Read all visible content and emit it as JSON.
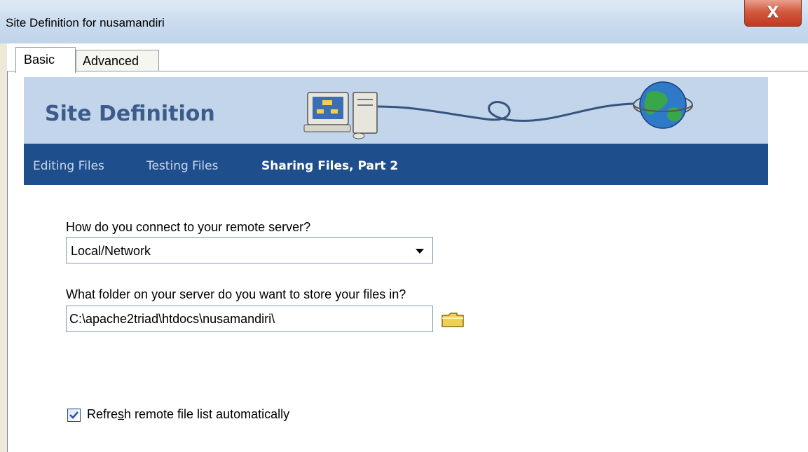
{
  "window": {
    "title": "Site Definition for nusamandiri",
    "close_label": "X"
  },
  "tabs": [
    {
      "label": "Basic",
      "active": true
    },
    {
      "label": "Advanced",
      "active": false
    }
  ],
  "banner": {
    "title": "Site Definition"
  },
  "wizard_steps": [
    {
      "label": "Editing Files",
      "active": false
    },
    {
      "label": "Testing Files",
      "active": false
    },
    {
      "label": "Sharing Files, Part 2",
      "active": true
    }
  ],
  "form": {
    "connect_question": "How do you connect to your remote server?",
    "connect_value": "Local/Network",
    "folder_question": "What folder on your server do you want to store your files in?",
    "folder_value": "C:\\apache2triad\\htdocs\\nusamandiri\\",
    "refresh_label_before": "Refre",
    "refresh_label_underlined": "s",
    "refresh_label_after": "h remote file list automatically",
    "refresh_checked": true
  },
  "icons": {
    "close": "close-icon",
    "dropdown": "chevron-down-icon",
    "browse": "folder-icon",
    "computer": "computer-icon",
    "globe": "globe-icon"
  },
  "colors": {
    "banner_bg": "#c2d5ea",
    "nav_bg": "#1e4e8c",
    "banner_title": "#3b5c8c"
  }
}
